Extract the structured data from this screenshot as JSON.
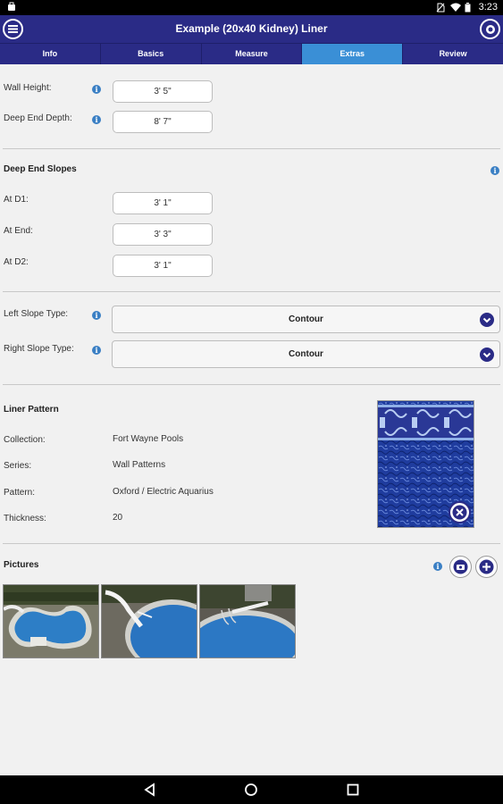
{
  "status_bar": {
    "time": "3:23"
  },
  "app": {
    "title": "Example (20x40 Kidney) Liner"
  },
  "tabs": [
    {
      "label": "Info"
    },
    {
      "label": "Basics"
    },
    {
      "label": "Measure"
    },
    {
      "label": "Extras",
      "active": true
    },
    {
      "label": "Review"
    }
  ],
  "walls": {
    "wall_height": {
      "label": "Wall Height:",
      "value": "3' 5\""
    },
    "deep_end_depth": {
      "label": "Deep End Depth:",
      "value": "8' 7\""
    }
  },
  "deep_end_slopes": {
    "title": "Deep End Slopes",
    "at_d1": {
      "label": "At D1:",
      "value": "3' 1\""
    },
    "at_end": {
      "label": "At End:",
      "value": "3' 3\""
    },
    "at_d2": {
      "label": "At D2:",
      "value": "3' 1\""
    }
  },
  "slope_types": {
    "left": {
      "label": "Left Slope Type:",
      "value": "Contour"
    },
    "right": {
      "label": "Right Slope Type:",
      "value": "Contour"
    }
  },
  "liner_pattern": {
    "title": "Liner Pattern",
    "collection": {
      "label": "Collection:",
      "value": "Fort Wayne Pools"
    },
    "series": {
      "label": "Series:",
      "value": "Wall Patterns"
    },
    "pattern": {
      "label": "Pattern:",
      "value": "Oxford / Electric Aquarius"
    },
    "thickness": {
      "label": "Thickness:",
      "value": "20"
    }
  },
  "pictures": {
    "title": "Pictures",
    "count": 3
  },
  "colors": {
    "primary": "#2a2b86",
    "active_tab": "#3a8fd6",
    "info": "#3a7fc4"
  },
  "icons": [
    "menu-icon",
    "settings-icon",
    "info-icon",
    "chevron-down-icon",
    "close-icon",
    "camera-icon",
    "add-icon",
    "back-icon",
    "home-icon",
    "recents-icon"
  ]
}
